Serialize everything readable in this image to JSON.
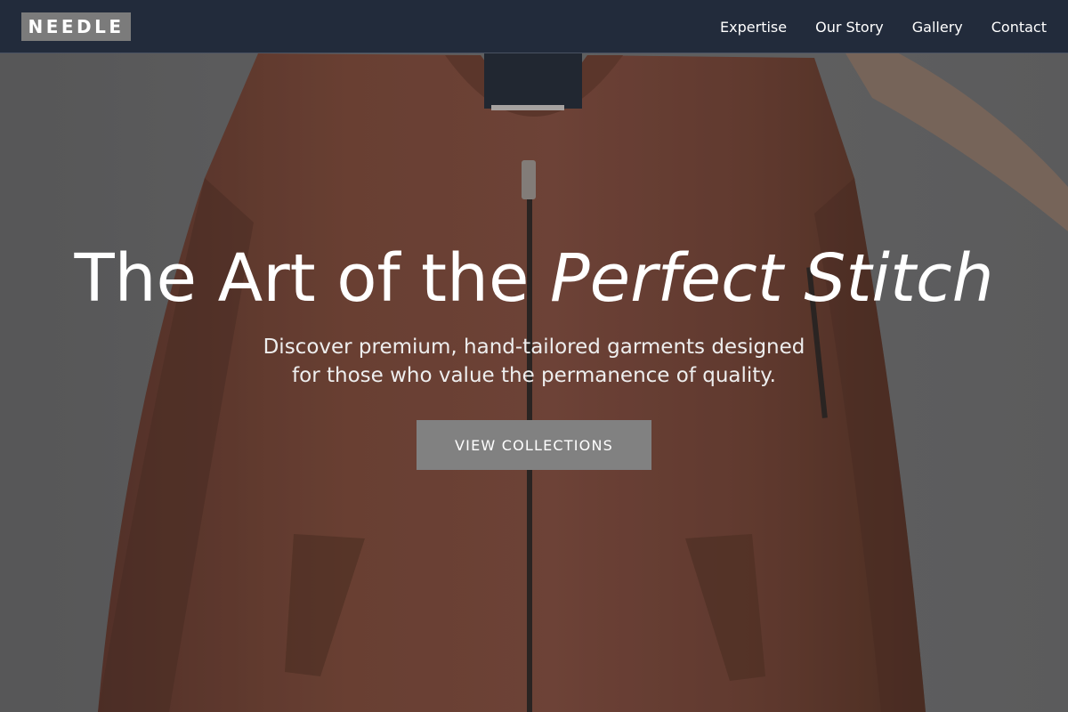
{
  "brand": {
    "name": "NEEDLE"
  },
  "nav": {
    "links": [
      {
        "label": "Expertise"
      },
      {
        "label": "Our Story"
      },
      {
        "label": "Gallery"
      },
      {
        "label": "Contact"
      }
    ]
  },
  "hero": {
    "headline_plain": "The Art of the",
    "headline_emphasis": "Perfect Stitch",
    "subtext_line1": "Discover premium, hand-tailored garments designed",
    "subtext_line2": "for those who value the permanence of quality.",
    "cta_label": "VIEW COLLECTIONS",
    "background_image": "rust-bomber-jacket-on-hanger"
  },
  "colors": {
    "navbar": "#222b3b",
    "logo_bg": "#7b7b7b",
    "cta_bg": "#818181",
    "jacket": "#7a4534",
    "backdrop": "#6f6f6f"
  }
}
